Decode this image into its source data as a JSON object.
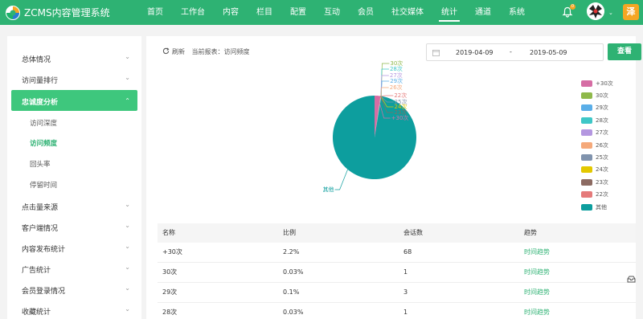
{
  "header": {
    "brand": "ZCMS内容管理系统",
    "nav": [
      "首页",
      "工作台",
      "内容",
      "栏目",
      "配置",
      "互动",
      "会员",
      "社交媒体",
      "统计",
      "通道",
      "系统"
    ],
    "active_nav": "统计",
    "notification_count": "0",
    "user_initial": "泽"
  },
  "sidebar": {
    "items": [
      {
        "label": "总体情况"
      },
      {
        "label": "访问量排行"
      },
      {
        "label": "忠诚度分析"
      },
      {
        "label": "点击量来源"
      },
      {
        "label": "客户端情况"
      },
      {
        "label": "内容发布统计"
      },
      {
        "label": "广告统计"
      },
      {
        "label": "会员登录情况"
      },
      {
        "label": "收藏统计"
      }
    ],
    "subitems": [
      "访问深度",
      "访问频度",
      "回头率",
      "停留时间"
    ],
    "current_sub": "访问频度"
  },
  "toolbar": {
    "refresh_label": "刷新",
    "report_label": "当前报表：访问频度"
  },
  "date_range": {
    "start": "2019-04-09",
    "separator": "-",
    "end": "2019-05-09",
    "query_label": "查看"
  },
  "chart_data": {
    "type": "pie",
    "slices": [
      {
        "name": "+30次",
        "value": 68,
        "percent": 2.2,
        "color": "#d66da4"
      },
      {
        "name": "30次",
        "value": 1,
        "percent": 0.03,
        "color": "#8fb94b"
      },
      {
        "name": "29次",
        "value": 3,
        "percent": 0.1,
        "color": "#5aaee8"
      },
      {
        "name": "28次",
        "value": 1,
        "percent": 0.03,
        "color": "#3ec7c7"
      },
      {
        "name": "27次",
        "value": 1,
        "percent": 0.03,
        "color": "#b497e0"
      },
      {
        "name": "26次",
        "value": 1,
        "percent": 0.03,
        "color": "#f5a97a"
      },
      {
        "name": "25次",
        "value": 1,
        "percent": 0.03,
        "color": "#8093ad"
      },
      {
        "name": "24次",
        "value": 1,
        "percent": 0.03,
        "color": "#e3c800"
      },
      {
        "name": "23次",
        "value": 1,
        "percent": 0.03,
        "color": "#8c6b62"
      },
      {
        "name": "22次",
        "value": 1,
        "percent": 0.03,
        "color": "#e57a7a"
      },
      {
        "name": "其他",
        "value": 2960,
        "percent": 97.5,
        "color": "#0d9e9e"
      }
    ]
  },
  "table": {
    "headers": [
      "名称",
      "比例",
      "会话数",
      "趋势"
    ],
    "rows": [
      {
        "name": "+30次",
        "ratio": "2.2%",
        "sessions": "68",
        "trend": "时间趋势"
      },
      {
        "name": "30次",
        "ratio": "0.03%",
        "sessions": "1",
        "trend": "时间趋势"
      },
      {
        "name": "29次",
        "ratio": "0.1%",
        "sessions": "3",
        "trend": "时间趋势"
      },
      {
        "name": "28次",
        "ratio": "0.03%",
        "sessions": "1",
        "trend": "时间趋势"
      }
    ]
  }
}
